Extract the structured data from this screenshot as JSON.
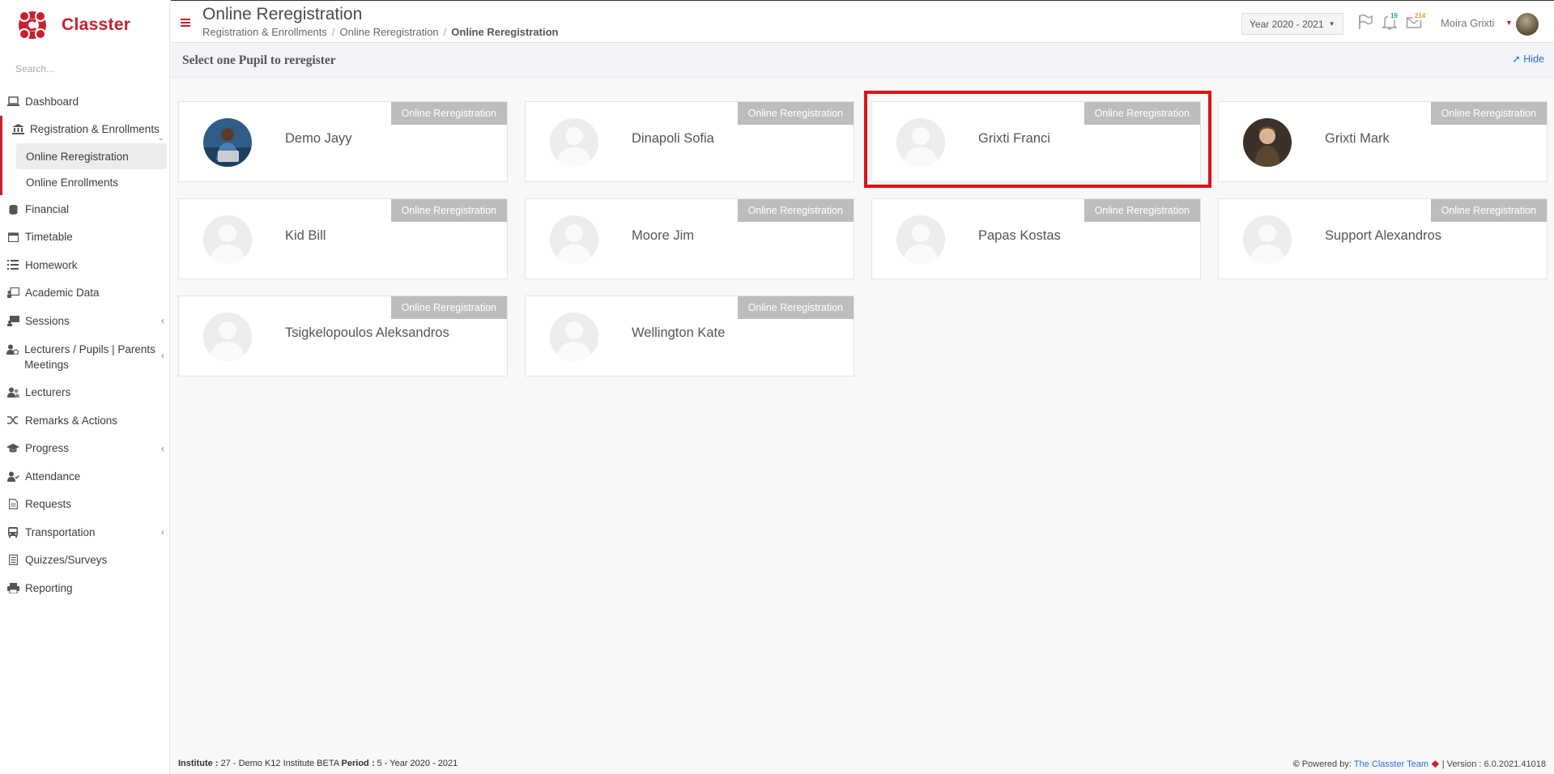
{
  "app": {
    "name": "Classter"
  },
  "search": {
    "placeholder": "Search..."
  },
  "sidebar": {
    "items": [
      {
        "label": "Dashboard",
        "icon": "laptop-icon"
      },
      {
        "label": "Registration & Enrollments",
        "icon": "bank-icon"
      },
      {
        "label": "Financial",
        "icon": "coins-icon"
      },
      {
        "label": "Timetable",
        "icon": "calendar-icon"
      },
      {
        "label": "Homework",
        "icon": "list-icon"
      },
      {
        "label": "Academic Data",
        "icon": "chart-board-icon"
      },
      {
        "label": "Sessions",
        "icon": "presentation-icon"
      },
      {
        "label": "Lecturers / Pupils | Parents Meetings",
        "icon": "user-clock-icon"
      },
      {
        "label": "Lecturers",
        "icon": "users-icon"
      },
      {
        "label": "Remarks & Actions",
        "icon": "shuffle-icon"
      },
      {
        "label": "Progress",
        "icon": "graduation-cap-icon"
      },
      {
        "label": "Attendance",
        "icon": "user-check-icon"
      },
      {
        "label": "Requests",
        "icon": "document-icon"
      },
      {
        "label": "Transportation",
        "icon": "bus-icon"
      },
      {
        "label": "Quizzes/Surveys",
        "icon": "checklist-icon"
      },
      {
        "label": "Reporting",
        "icon": "printer-icon"
      }
    ],
    "sub_items": [
      {
        "label": "Online Reregistration"
      },
      {
        "label": "Online Enrollments"
      }
    ]
  },
  "header": {
    "title": "Online Reregistration",
    "breadcrumb": [
      "Registration & Enrollments",
      "Online Reregistration",
      "Online Reregistration"
    ],
    "year": "Year 2020 - 2021",
    "notifications_count": "19",
    "messages_count": "214",
    "user_name": "Moira Grixti"
  },
  "subheader": {
    "title": "Select one Pupil to reregister",
    "hide_label": "Hide"
  },
  "cards": [
    {
      "name": "Demo Jayy",
      "tag": "Online Reregistration",
      "photo": "photo-man-laptop"
    },
    {
      "name": "Dinapoli Sofia",
      "tag": "Online Reregistration",
      "photo": "placeholder"
    },
    {
      "name": "Grixti Franci",
      "tag": "Online Reregistration",
      "photo": "placeholder"
    },
    {
      "name": "Grixti Mark",
      "tag": "Online Reregistration",
      "photo": "photo-child"
    },
    {
      "name": "Kid Bill",
      "tag": "Online Reregistration",
      "photo": "placeholder"
    },
    {
      "name": "Moore Jim",
      "tag": "Online Reregistration",
      "photo": "placeholder"
    },
    {
      "name": "Papas Kostas",
      "tag": "Online Reregistration",
      "photo": "placeholder"
    },
    {
      "name": "Support Alexandros",
      "tag": "Online Reregistration",
      "photo": "placeholder"
    },
    {
      "name": "Tsigkelopoulos Aleksandros",
      "tag": "Online Reregistration",
      "photo": "placeholder"
    },
    {
      "name": "Wellington Kate",
      "tag": "Online Reregistration",
      "photo": "placeholder"
    }
  ],
  "footer": {
    "institute_label": "Institute :",
    "institute_value": "27 - Demo K12 Institute BETA",
    "period_label": "Period :",
    "period_value": "5 - Year 2020 - 2021",
    "powered_by": "Powered by:",
    "team": "The Classter Team",
    "version": "| Version : 6.0.2021.41018"
  },
  "colors": {
    "brand": "#c8202f",
    "link": "#2a6fc9",
    "highlight": "#e01212",
    "tag": "#bdbdbd"
  }
}
